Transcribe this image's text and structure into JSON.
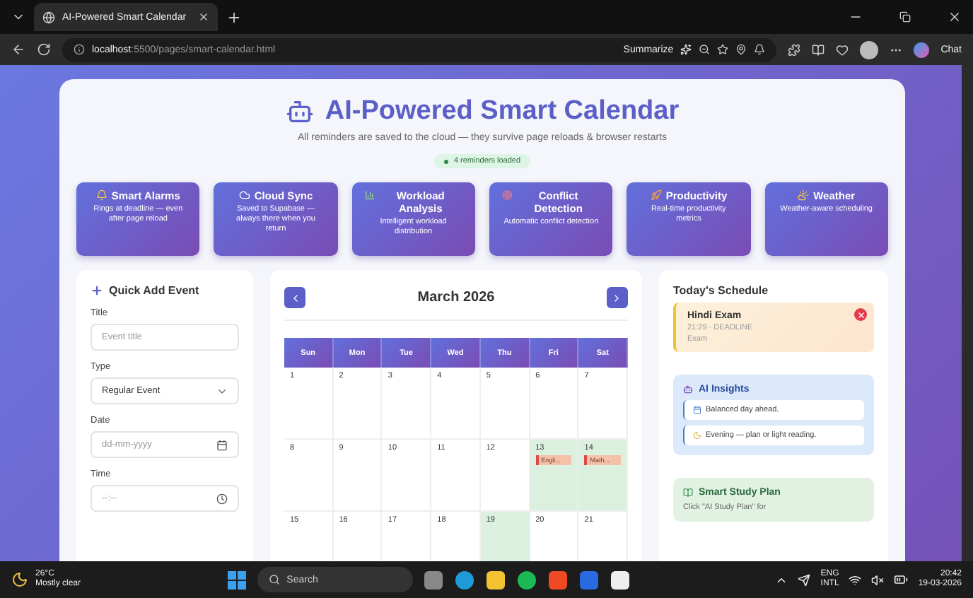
{
  "browser": {
    "tab_title": "AI-Powered Smart Calendar",
    "url_host": "localhost",
    "url_path": ":5500/pages/smart-calendar.html",
    "summarize": "Summarize",
    "chat": "Chat"
  },
  "header": {
    "title": "AI-Powered Smart Calendar",
    "subtitle": "All reminders are saved to the cloud — they survive page reloads & browser restarts",
    "status": "4 reminders loaded"
  },
  "features": [
    {
      "kind": "alarm",
      "title": "Smart Alarms",
      "description": "Rings at deadline — even after page reload"
    },
    {
      "kind": "cloud",
      "title": "Cloud Sync",
      "description": "Saved to Supabase — always there when you return"
    },
    {
      "kind": "chart",
      "title": "Workload Analysis",
      "description": "Intelligent workload distribution"
    },
    {
      "kind": "target",
      "title": "Conflict Detection",
      "description": "Automatic conflict detection"
    },
    {
      "kind": "rocket",
      "title": "Productivity",
      "description": "Real-time productivity metrics"
    },
    {
      "kind": "weather",
      "title": "Weather",
      "description": "Weather-aware scheduling"
    }
  ],
  "quick_add": {
    "heading": "Quick Add Event",
    "fields": [
      {
        "kind": "text",
        "label": "Title",
        "placeholder": "Event title"
      },
      {
        "kind": "select",
        "label": "Type",
        "value": "Regular Event"
      },
      {
        "kind": "date",
        "label": "Date",
        "placeholder": "dd-mm-yyyy"
      },
      {
        "kind": "time",
        "label": "Time",
        "placeholder": "--:--"
      }
    ]
  },
  "calendar": {
    "month": "March 2026",
    "weekdays": [
      "Sun",
      "Mon",
      "Tue",
      "Wed",
      "Thu",
      "Fri",
      "Sat"
    ],
    "weeks": [
      [
        {
          "day": "1",
          "highlighted": false
        },
        {
          "day": "2",
          "highlighted": false
        },
        {
          "day": "3",
          "highlighted": false
        },
        {
          "day": "4",
          "highlighted": false
        },
        {
          "day": "5",
          "highlighted": false
        },
        {
          "day": "6",
          "highlighted": false
        },
        {
          "day": "7",
          "highlighted": false
        }
      ],
      [
        {
          "day": "8",
          "highlighted": false
        },
        {
          "day": "9",
          "highlighted": false
        },
        {
          "day": "10",
          "highlighted": false
        },
        {
          "day": "11",
          "highlighted": false
        },
        {
          "day": "12",
          "highlighted": false
        },
        {
          "day": "13",
          "highlighted": true,
          "events": [
            "Engli..."
          ]
        },
        {
          "day": "14",
          "highlighted": true,
          "events": [
            "Math..."
          ]
        }
      ],
      [
        {
          "day": "15",
          "highlighted": false
        },
        {
          "day": "16",
          "highlighted": false
        },
        {
          "day": "17",
          "highlighted": false
        },
        {
          "day": "18",
          "highlighted": false
        },
        {
          "day": "19",
          "highlighted": true
        },
        {
          "day": "20",
          "highlighted": false
        },
        {
          "day": "21",
          "highlighted": false
        }
      ]
    ]
  },
  "schedule": {
    "heading": "Today's Schedule",
    "items": [
      {
        "title": "Hindi Exam",
        "meta": "21:29 · DEADLINE",
        "category": "Exam"
      }
    ]
  },
  "ai_insights": {
    "heading": "AI Insights",
    "items": [
      {
        "kind": "calendar",
        "text": "Balanced day ahead."
      },
      {
        "kind": "moon",
        "text": "Evening — plan or light reading."
      }
    ]
  },
  "study_plan": {
    "heading": "Smart Study Plan",
    "text": "Click \"AI Study Plan\" for"
  },
  "taskbar": {
    "temperature": "26°C",
    "weather": "Mostly clear",
    "search": "Search",
    "language": "ENG",
    "layout": "INTL",
    "time": "20:42",
    "date": "19-03-2026"
  }
}
